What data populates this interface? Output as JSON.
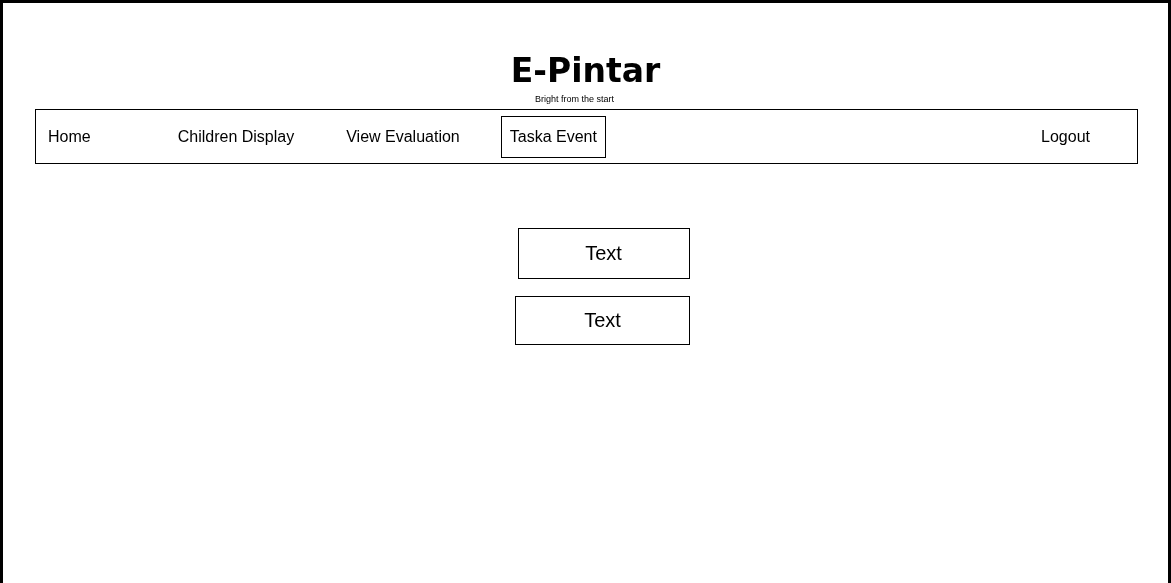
{
  "header": {
    "title": "E-Pintar",
    "tagline": "Bright from the start"
  },
  "nav": {
    "items": [
      {
        "label": "Home",
        "selected": false
      },
      {
        "label": "Children Display",
        "selected": false
      },
      {
        "label": "View Evaluation",
        "selected": false
      },
      {
        "label": "Taska Event",
        "selected": true
      }
    ],
    "logout": "Logout"
  },
  "content": {
    "buttons": [
      "Text",
      "Text"
    ]
  }
}
